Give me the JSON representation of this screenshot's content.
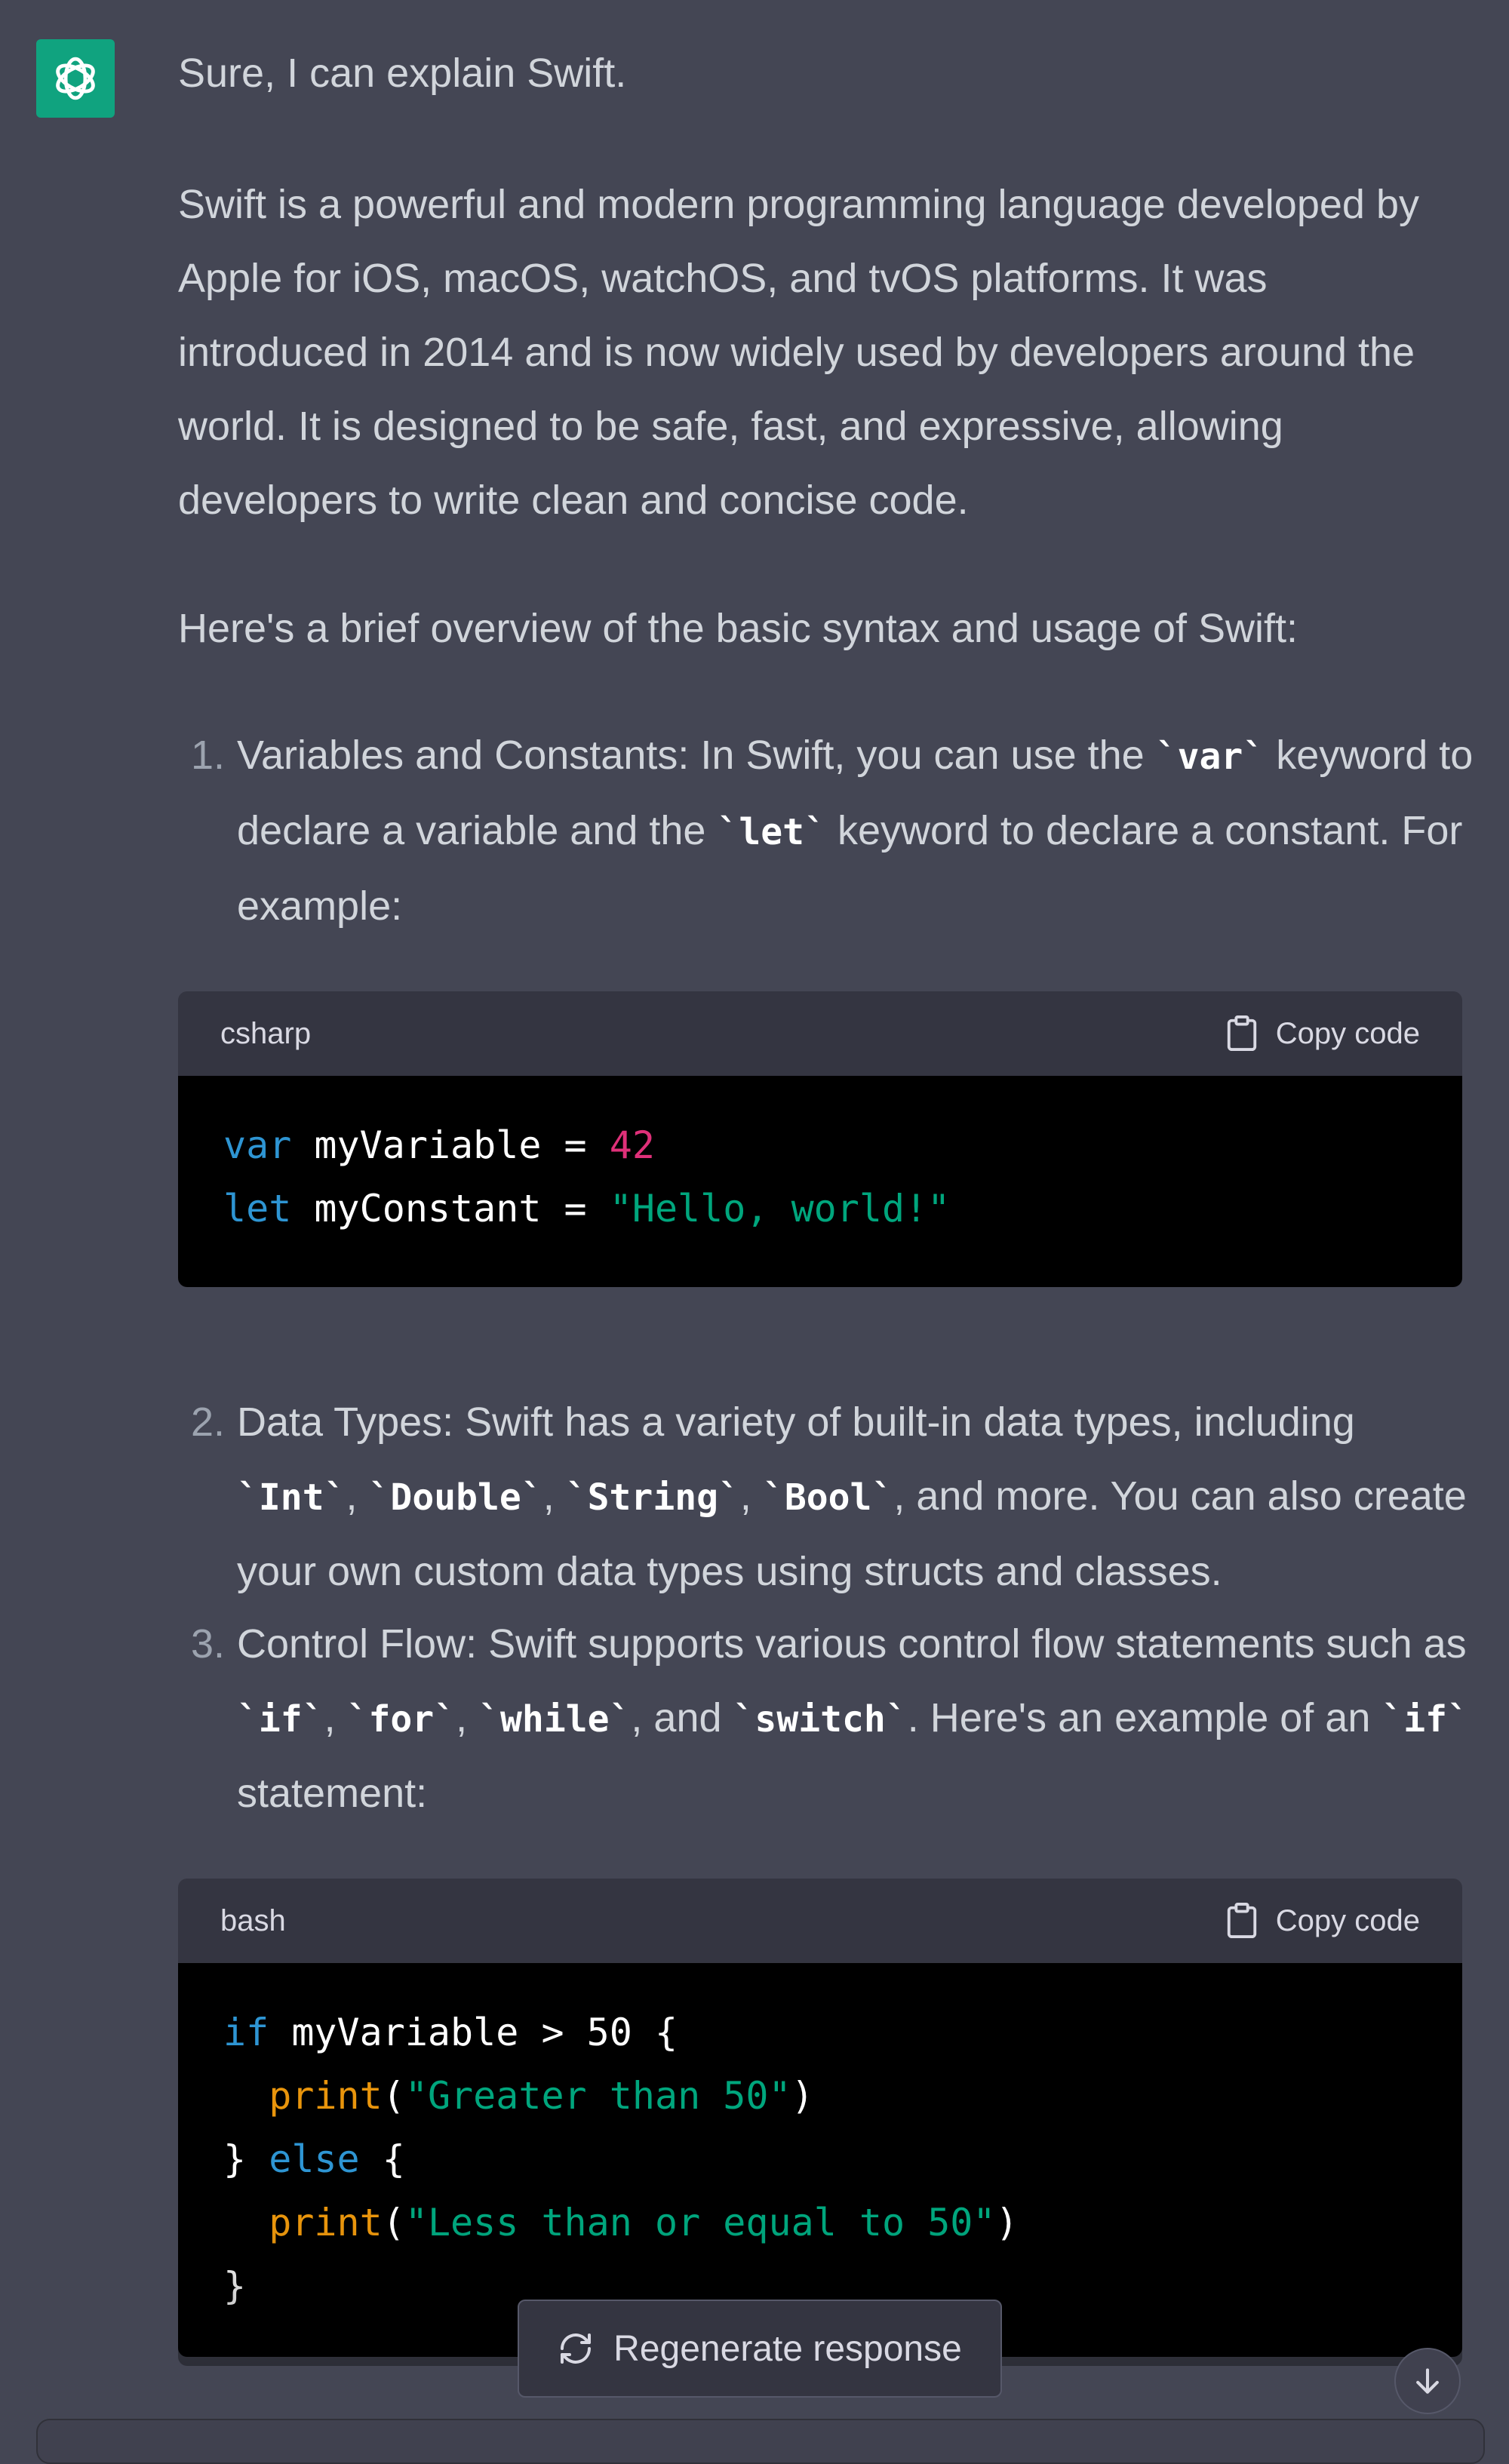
{
  "message": {
    "greeting": "Sure, I can explain Swift.",
    "intro": "Swift is a powerful and modern programming language developed by Apple for iOS, macOS, watchOS, and tvOS platforms. It was introduced in 2014 and is now widely used by developers around the world. It is designed to be safe, fast, and expressive, allowing developers to write clean and concise code.",
    "overview": "Here's a brief overview of the basic syntax and usage of Swift:",
    "items": [
      {
        "number": "1.",
        "t1": "Variables and Constants: In Swift, you can use the ",
        "c1": "`var`",
        "t2": " keyword to declare a variable and the ",
        "c2": "`let`",
        "t3": " keyword to declare a constant. For example:"
      },
      {
        "number": "2.",
        "t1": "Data Types: Swift has a variety of built-in data types, including ",
        "c1": "`Int`",
        "s1": ", ",
        "c2": "`Double`",
        "s2": ", ",
        "c3": "`String`",
        "s3": ", ",
        "c4": "`Bool`",
        "t2": ", and more. You can also create your own custom data types using structs and classes."
      },
      {
        "number": "3.",
        "t1": "Control Flow: Swift supports various control flow statements such as ",
        "c1": "`if`",
        "s1": ", ",
        "c2": "`for`",
        "s2": ", ",
        "c3": "`while`",
        "s3": ", and ",
        "c4": "`switch`",
        "t2": ". Here's an example of an ",
        "c5": "`if`",
        "t3": " statement:"
      }
    ]
  },
  "code_blocks": [
    {
      "language": "csharp",
      "copy_label": "Copy code",
      "lines": [
        [
          "var",
          " myVariable = ",
          "42"
        ],
        [
          "let",
          " myConstant = ",
          "\"Hello, world!\""
        ]
      ]
    },
    {
      "language": "bash",
      "copy_label": "Copy code",
      "lines": [
        [
          "if",
          " myVariable > 50 {"
        ],
        [
          "  ",
          "print",
          "(",
          "\"Greater than 50\"",
          ")"
        ],
        [
          "} ",
          "else",
          " {"
        ],
        [
          "  ",
          "print",
          "(",
          "\"Less than or equal to 50\"",
          ")"
        ],
        [
          "}"
        ]
      ]
    }
  ],
  "regenerate_label": "Regenerate response",
  "icons": [
    "openai-logo-icon",
    "clipboard-icon",
    "refresh-icon",
    "arrow-down-icon"
  ],
  "colors": {
    "background": "#444654",
    "avatar": "#10a37f",
    "code_header": "#343541",
    "code_body": "#000000",
    "keyword": "#2e95d3",
    "number": "#df3079",
    "string": "#00a67d",
    "function": "#e9950c"
  }
}
